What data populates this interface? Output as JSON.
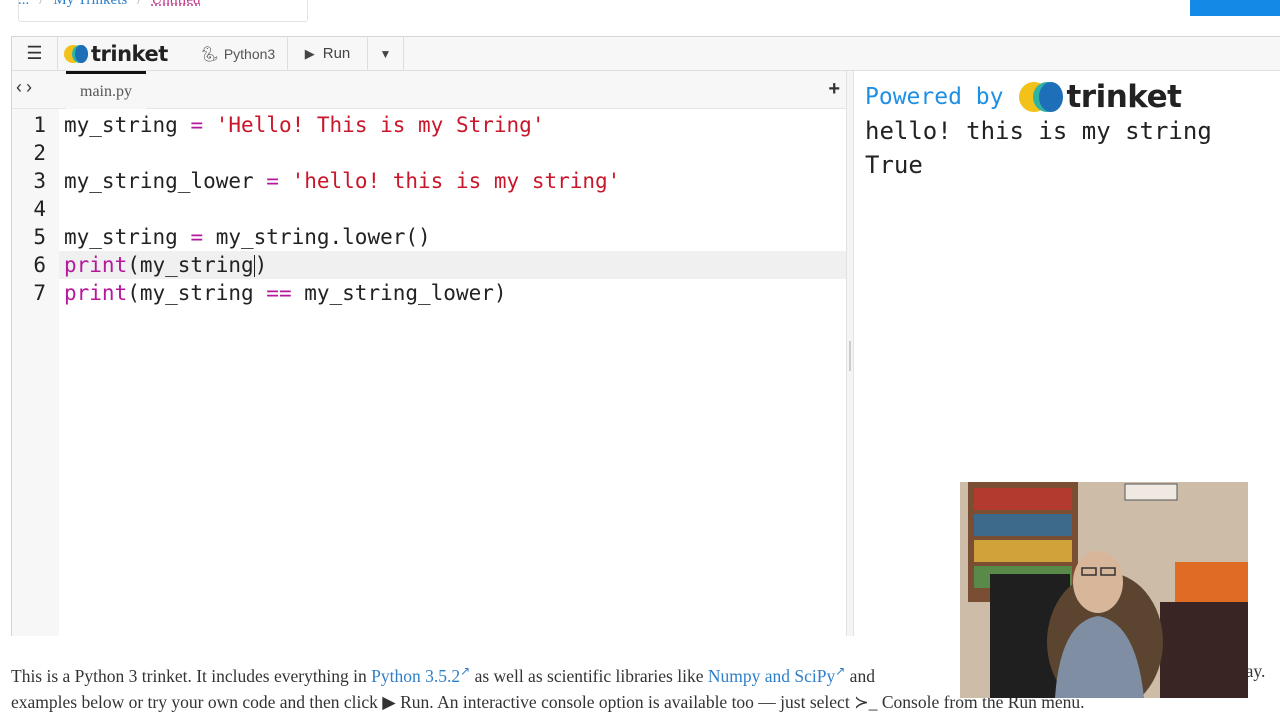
{
  "breadcrumb": {
    "home": "...",
    "parent": "My Trinkets",
    "current": "Untitled"
  },
  "toolbar": {
    "brand": "trinket",
    "language": "Python3",
    "run_label": "Run"
  },
  "editor": {
    "file_tab": "main.py",
    "lines": [
      {
        "num": "1",
        "parts": [
          [
            "my_string ",
            ""
          ],
          [
            "=",
            "op"
          ],
          [
            " ",
            ""
          ],
          [
            "'Hello! This is my String'",
            "str"
          ]
        ]
      },
      {
        "num": "2",
        "parts": []
      },
      {
        "num": "3",
        "parts": [
          [
            "my_string_lower ",
            ""
          ],
          [
            "=",
            "op"
          ],
          [
            " ",
            ""
          ],
          [
            "'hello! this is my string'",
            "str"
          ]
        ]
      },
      {
        "num": "4",
        "parts": []
      },
      {
        "num": "5",
        "parts": [
          [
            "my_string ",
            ""
          ],
          [
            "=",
            "op"
          ],
          [
            " my_string.lower()",
            ""
          ]
        ]
      },
      {
        "num": "6",
        "parts": [
          [
            "print",
            "kw"
          ],
          [
            "(my_string",
            ""
          ],
          [
            "|",
            "cursor"
          ],
          [
            ")",
            ""
          ]
        ]
      },
      {
        "num": "7",
        "parts": [
          [
            "print",
            "kw"
          ],
          [
            "(my_string ",
            ""
          ],
          [
            "==",
            "op"
          ],
          [
            " my_string_lower)",
            ""
          ]
        ]
      }
    ],
    "active_line": 6
  },
  "output": {
    "powered_label": "Powered by",
    "brand": "trinket",
    "lines": [
      "hello! this is my string",
      "True"
    ]
  },
  "description": {
    "line1_a": "This is a Python 3 trinket. It includes everything in ",
    "python_link": "Python 3.5.2",
    "line1_b": " as well as scientific libraries like ",
    "numpy_link": "Numpy and SciPy",
    "line1_c": " and",
    "line1_end": "way.",
    "line2_a": "examples below or try your own code and then click ",
    "run_glyph": "▶",
    "line2_b": " Run. An interactive console option is available too — just select ",
    "line2_c": "≻_ Console from the Run menu."
  },
  "colors": {
    "accent": "#1e90e6",
    "string": "#c8162a",
    "keyword": "#b5179e",
    "link": "#2f7fc8"
  },
  "icons": [
    "hamburger-icon",
    "python-icon",
    "play-icon",
    "caret-down-icon",
    "chevron-left-icon",
    "chevron-right-icon",
    "plus-icon",
    "external-link-icon"
  ]
}
